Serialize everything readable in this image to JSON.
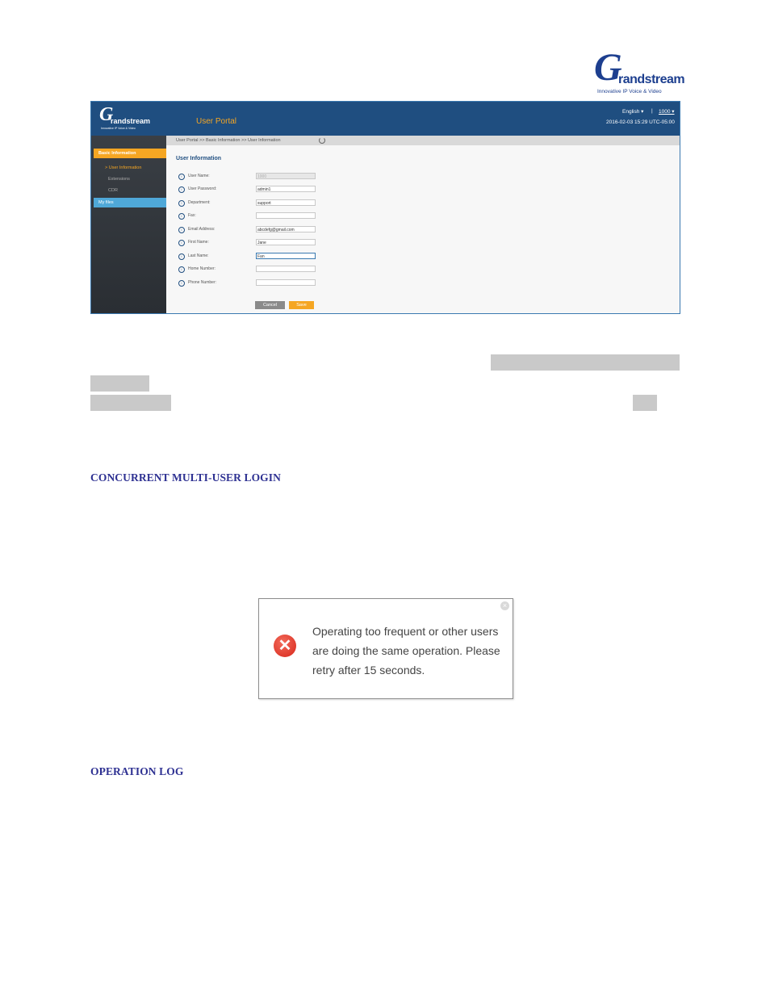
{
  "brand": {
    "logo_g": "G",
    "logo_word": "randstream",
    "tagline": "Innovative IP Voice & Video"
  },
  "portal": {
    "logo_g": "G",
    "logo_word": "randstream",
    "logo_tagline": "Innovative IP Voice & Video",
    "title": "User Portal",
    "language": "English ▾",
    "separator": "|",
    "user": "1000 ▾",
    "datetime": "2016-02-03 15:29 UTC-05:00",
    "breadcrumb": "User Portal >> Basic Information >> User Information",
    "sidebar": {
      "basic_information": "Basic Information",
      "user_information": "> User Information",
      "extensions": "Extensions",
      "cdr": "CDR",
      "my_files": "My files"
    },
    "section_title": "User Information",
    "fields": [
      {
        "label": "User Name:",
        "value": "1000"
      },
      {
        "label": "User Password:",
        "value": "admin1"
      },
      {
        "label": "Department:",
        "value": "support"
      },
      {
        "label": "Fax:",
        "value": ""
      },
      {
        "label": "Email Address:",
        "value": "abcdefg@gmail.com"
      },
      {
        "label": "First Name:",
        "value": "Jane"
      },
      {
        "label": "Last Name:",
        "value": "Fan"
      },
      {
        "label": "Home Number:",
        "value": ""
      },
      {
        "label": "Phone Number:",
        "value": ""
      }
    ],
    "cancel_label": "Cancel",
    "save_label": "Save"
  },
  "headings": {
    "concurrent": "CONCURRENT MULTI-USER LOGIN",
    "operation_log": "OPERATION LOG"
  },
  "dialog": {
    "message": "Operating too frequent or other users are doing the same operation. Please retry after 15 seconds.",
    "close_glyph": "×",
    "error_glyph": "✕"
  }
}
